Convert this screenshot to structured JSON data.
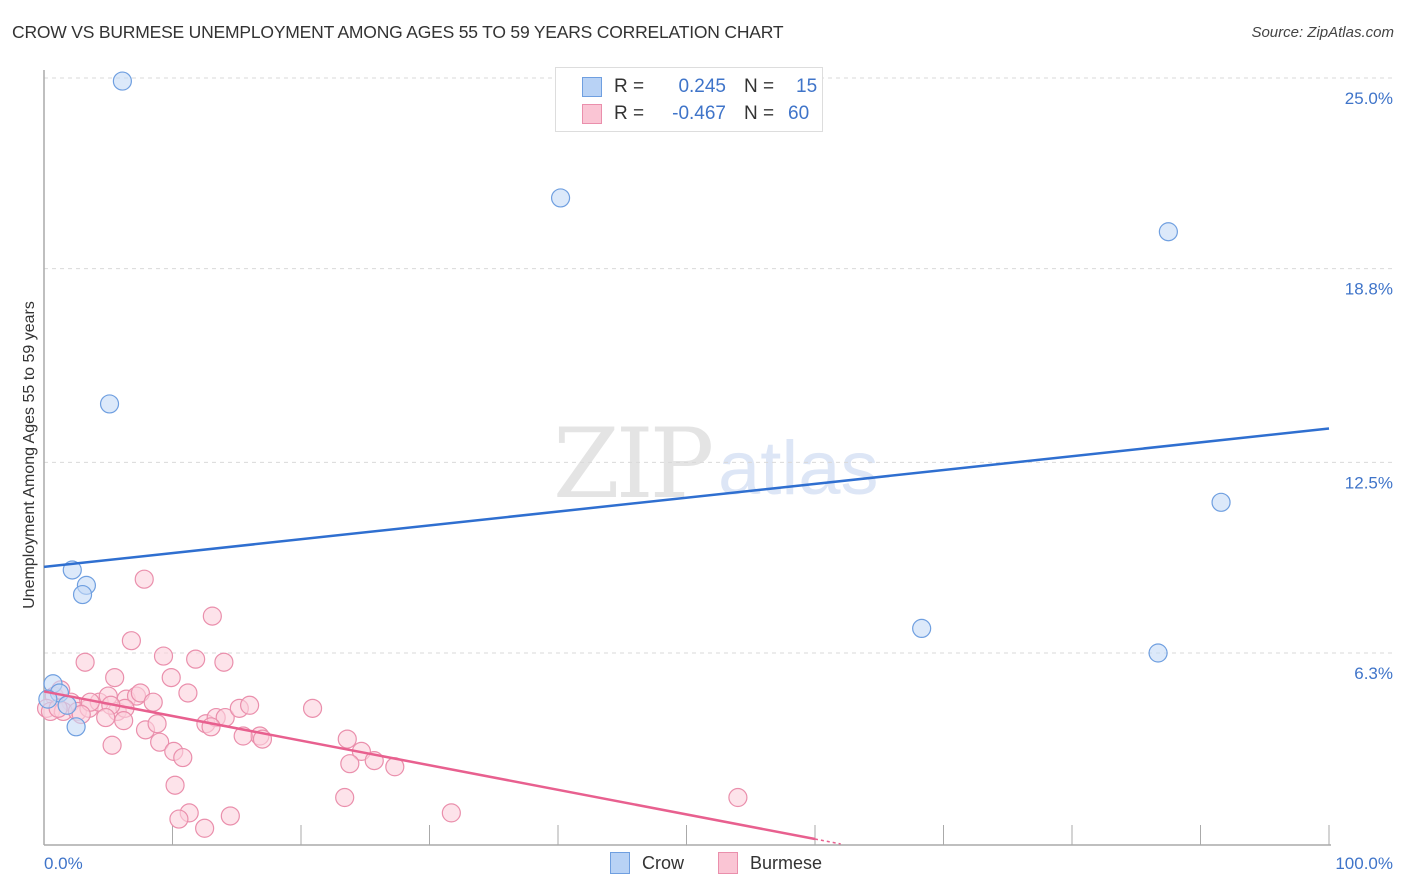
{
  "header": {
    "title": "CROW VS BURMESE UNEMPLOYMENT AMONG AGES 55 TO 59 YEARS CORRELATION CHART",
    "source": "Source: ZipAtlas.com"
  },
  "watermark": {
    "zip": "ZIP",
    "atlas": "atlas"
  },
  "legend": {
    "rows": [
      {
        "r_label": "R =",
        "r_value": "0.245",
        "n_label": "N =",
        "n_value": "15",
        "color": "#b8d2f5",
        "border": "#6f9fe0"
      },
      {
        "r_label": "R =",
        "r_value": "-0.467",
        "n_label": "N =",
        "n_value": "60",
        "color": "#fac5d4",
        "border": "#ea8fac"
      }
    ]
  },
  "bottom_legend": [
    {
      "label": "Crow",
      "color": "#b8d2f5",
      "border": "#6f9fe0"
    },
    {
      "label": "Burmese",
      "color": "#fac5d4",
      "border": "#ea8fac"
    }
  ],
  "chart_data": {
    "type": "scatter",
    "title": "CROW VS BURMESE UNEMPLOYMENT AMONG AGES 55 TO 59 YEARS CORRELATION CHART",
    "xlabel": "",
    "ylabel": "Unemployment Among Ages 55 to 59 years",
    "xlim": [
      0,
      100
    ],
    "ylim": [
      0,
      25.5
    ],
    "x_tick_labels": [
      "0.0%",
      "100.0%"
    ],
    "y_ticks": [
      6.3,
      12.5,
      18.8,
      25.0
    ],
    "y_tick_labels": [
      "6.3%",
      "12.5%",
      "18.8%",
      "25.0%"
    ],
    "grid": true,
    "legend_position": "top-center",
    "series": [
      {
        "name": "Crow",
        "color": "#6f9fe0",
        "fill": "#c5daf7",
        "trend_color": "#2f6fd0",
        "R": 0.245,
        "N": 15,
        "trend": {
          "x": [
            0,
            100
          ],
          "y": [
            9.1,
            13.6
          ]
        },
        "points": [
          [
            6.1,
            24.9
          ],
          [
            40.2,
            21.1
          ],
          [
            87.5,
            20.0
          ],
          [
            5.1,
            14.4
          ],
          [
            91.6,
            11.2
          ],
          [
            2.2,
            9.0
          ],
          [
            3.3,
            8.5
          ],
          [
            3.0,
            8.2
          ],
          [
            68.3,
            7.1
          ],
          [
            86.7,
            6.3
          ],
          [
            0.7,
            5.3
          ],
          [
            1.2,
            5.0
          ],
          [
            0.3,
            4.8
          ],
          [
            1.8,
            4.6
          ],
          [
            2.5,
            3.9
          ]
        ]
      },
      {
        "name": "Burmese",
        "color": "#ea8fac",
        "fill": "#fbd0dc",
        "trend_color": "#e8608f",
        "R": -0.467,
        "N": 60,
        "trend": {
          "x": [
            0,
            60
          ],
          "y": [
            5.05,
            0.25
          ]
        },
        "trend_dashed": {
          "x": [
            60,
            62
          ],
          "y": [
            0.25,
            0.09
          ]
        },
        "points": [
          [
            7.8,
            8.7
          ],
          [
            13.1,
            7.5
          ],
          [
            3.2,
            6.0
          ],
          [
            6.8,
            6.7
          ],
          [
            9.3,
            6.2
          ],
          [
            11.8,
            6.1
          ],
          [
            14.0,
            6.0
          ],
          [
            5.5,
            5.5
          ],
          [
            9.9,
            5.5
          ],
          [
            0.8,
            4.9
          ],
          [
            1.3,
            5.1
          ],
          [
            2.1,
            4.7
          ],
          [
            0.2,
            4.5
          ],
          [
            0.5,
            4.4
          ],
          [
            1.5,
            4.4
          ],
          [
            2.6,
            4.4
          ],
          [
            3.5,
            4.5
          ],
          [
            4.3,
            4.7
          ],
          [
            5.0,
            4.9
          ],
          [
            5.7,
            4.4
          ],
          [
            6.4,
            4.8
          ],
          [
            7.2,
            4.9
          ],
          [
            7.5,
            5.0
          ],
          [
            8.5,
            4.7
          ],
          [
            6.3,
            4.5
          ],
          [
            5.2,
            4.6
          ],
          [
            4.8,
            4.2
          ],
          [
            3.6,
            4.7
          ],
          [
            1.1,
            4.5
          ],
          [
            2.9,
            4.3
          ],
          [
            11.2,
            5.0
          ],
          [
            12.6,
            4.0
          ],
          [
            13.4,
            4.2
          ],
          [
            14.1,
            4.2
          ],
          [
            15.2,
            4.5
          ],
          [
            16.0,
            4.6
          ],
          [
            16.8,
            3.6
          ],
          [
            17.0,
            3.5
          ],
          [
            15.5,
            3.6
          ],
          [
            13.0,
            3.9
          ],
          [
            7.9,
            3.8
          ],
          [
            8.8,
            4.0
          ],
          [
            9.0,
            3.4
          ],
          [
            6.2,
            4.1
          ],
          [
            5.3,
            3.3
          ],
          [
            10.1,
            3.1
          ],
          [
            10.8,
            2.9
          ],
          [
            20.9,
            4.5
          ],
          [
            23.6,
            3.5
          ],
          [
            24.7,
            3.1
          ],
          [
            23.8,
            2.7
          ],
          [
            25.7,
            2.8
          ],
          [
            27.3,
            2.6
          ],
          [
            10.2,
            2.0
          ],
          [
            11.3,
            1.1
          ],
          [
            10.5,
            0.9
          ],
          [
            12.5,
            0.6
          ],
          [
            14.5,
            1.0
          ],
          [
            23.4,
            1.6
          ],
          [
            31.7,
            1.1
          ],
          [
            54.0,
            1.6
          ]
        ]
      }
    ]
  }
}
